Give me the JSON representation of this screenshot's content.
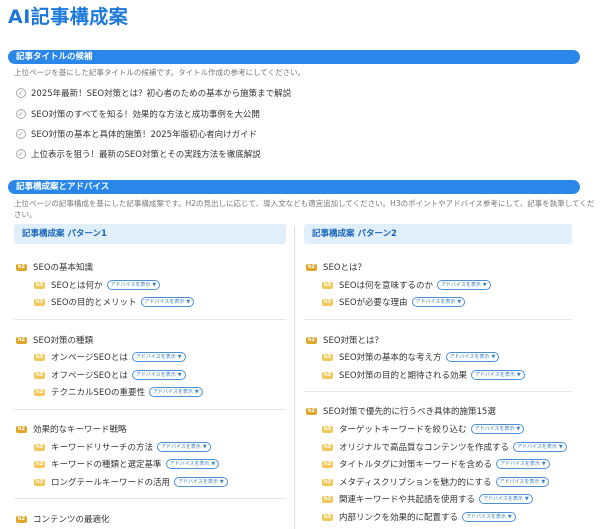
{
  "page": {
    "title": "AI記事構成案"
  },
  "titles_section": {
    "heading": "記事タイトルの候補",
    "description": "上位ページを基にした記事タイトルの候補です。タイトル作成の参考にしてください。",
    "items": [
      "2025年最新！SEO対策とは？初心者のための基本から施策まで解説",
      "SEO対策のすべてを知る！効果的な方法と成功事例を大公開",
      "SEO対策の基本と具体的施策！2025年版初心者向けガイド",
      "上位表示を狙う！最新のSEO対策とその実践方法を徹底解説"
    ]
  },
  "outline_section": {
    "heading": "記事構成案とアドバイス",
    "description": "上位ページの記事構成を基にした記事構成案です。H2の見出しに応じて、導入文なども適宜追加してください。H3のポイントやアドバイス参考にして、記事を執筆してください。",
    "advice_label": "アドバイスを表示",
    "pattern1": {
      "title": "記事構成案 パターン1",
      "groups": [
        {
          "h2": "SEOの基本知識",
          "h3": [
            "SEOとは何か",
            "SEOの目的とメリット"
          ]
        },
        {
          "h2": "SEO対策の種類",
          "h3": [
            "オンページSEOとは",
            "オフページSEOとは",
            "テクニカルSEOの重要性"
          ]
        },
        {
          "h2": "効果的なキーワード戦略",
          "h3": [
            "キーワードリサーチの方法",
            "キーワードの種類と選定基準",
            "ロングテールキーワードの活用"
          ]
        },
        {
          "h2": "コンテンツの最適化",
          "h3": []
        }
      ]
    },
    "pattern2": {
      "title": "記事構成案 パターン2",
      "groups": [
        {
          "h2": "SEOとは？",
          "h3": [
            "SEOは何を意味するのか",
            "SEOが必要な理由"
          ]
        },
        {
          "h2": "SEO対策とは？",
          "h3": [
            "SEO対策の基本的な考え方",
            "SEO対策の目的と期待される効果"
          ]
        },
        {
          "h2": "SEO対策で優先的に行うべき具体的施策15選",
          "h3": [
            "ターゲットキーワードを絞り込む",
            "オリジナルで高品質なコンテンツを作成する",
            "タイトルタグに対策キーワードを含める",
            "メタディスクリプションを魅力的にする",
            "関連キーワードや共起語を使用する",
            "内部リンクを効果的に配置する"
          ]
        }
      ]
    }
  },
  "colors": {
    "accent": "#2a86e8",
    "title": "#1e78dc",
    "h2_tag": "#e0a62a",
    "h3_tag": "#f0c95a"
  },
  "icons": {
    "check": "check-circle-icon",
    "caret": "caret-down-icon"
  }
}
